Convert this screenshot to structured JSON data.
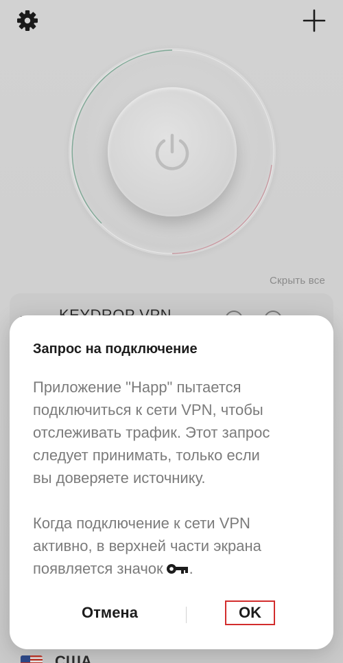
{
  "background": {
    "hide_all_label": "Скрыть все",
    "server_name": "KEYDROP VPN",
    "bottom_server_name": "США",
    "icons": [
      "settings-gear-icon",
      "plus-icon",
      "power-icon",
      "refresh-icon",
      "info-icon",
      "us-flag-icon"
    ]
  },
  "dialog": {
    "title": "Запрос на подключение",
    "paragraph1": "Приложение \"Happ\" пытается\nподключиться к сети VPN, чтобы\nотслеживать трафик. Этот запрос\nследует принимать, только если\nвы доверяете источнику.",
    "paragraph2": "Когда подключение к сети VPN\nактивно, в верхней части экрана\nпоявляется значок",
    "paragraph2_end": ".",
    "key_icon": "key-icon",
    "cancel_label": "Отмена",
    "ok_label": "OK"
  },
  "colors": {
    "ok_highlight_border": "#d22c2c",
    "dialog_bg": "#ffffff",
    "body_text": "#7b7b7b"
  }
}
